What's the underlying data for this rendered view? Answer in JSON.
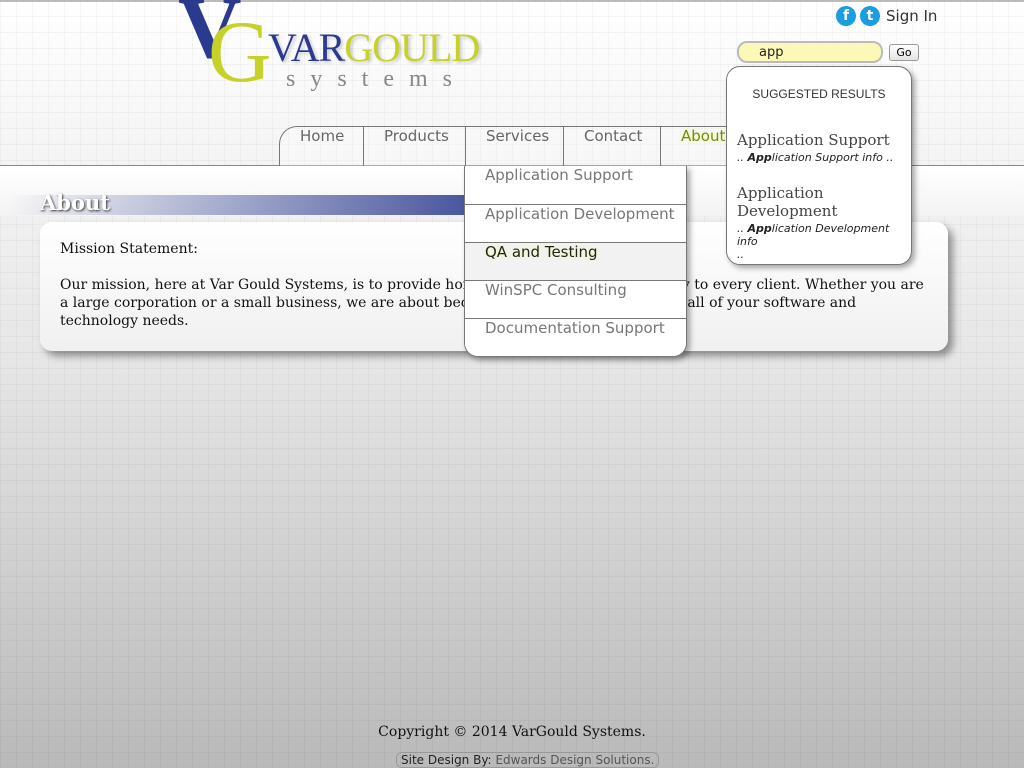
{
  "logo": {
    "monogram_v": "V",
    "monogram_g": "G",
    "brand_var": "VAR",
    "brand_gould": "GOULD",
    "tagline": "systems"
  },
  "header": {
    "sign_in": "Sign In",
    "facebook_icon": "f",
    "twitter_icon": "t",
    "search": {
      "value": "app",
      "go_label": "Go"
    }
  },
  "suggestions": {
    "title": "SUGGESTED RESULTS",
    "items": [
      {
        "title": "Application Support",
        "prefix": "..",
        "match": "App",
        "rest": "lication Support info ..",
        "suffix": ""
      },
      {
        "title": "Application Development",
        "prefix": "..",
        "match": "App",
        "rest": "lication Development info",
        "suffix": ".."
      }
    ]
  },
  "nav": {
    "items": [
      "Home",
      "Products",
      "Services",
      "Contact",
      "About"
    ],
    "active": "About"
  },
  "services_menu": {
    "items": [
      "Application Support",
      "Application Development",
      "QA and Testing",
      "WinSPC Consulting",
      "Documentation Support"
    ],
    "hovered": "QA and Testing"
  },
  "page": {
    "title": "About",
    "heading": "Mission Statement:",
    "body": "Our mission, here at Var Gould Systems, is to provide honesty, duty, loyalty and integrity to every client. Whether you are a large corporation or a small business, we are about becoming your go-to company for all of your software and technology needs."
  },
  "footer": {
    "copyright": "Copyright © 2014 VarGould Systems.",
    "credit_label": "Site Design By:",
    "credit_name": "Edwards Design Solutions."
  },
  "colors": {
    "brand_blue": "#2b3a8f",
    "brand_green": "#c6d22a",
    "search_bg": "#fbf8b8",
    "social": "#1a9ee0"
  }
}
